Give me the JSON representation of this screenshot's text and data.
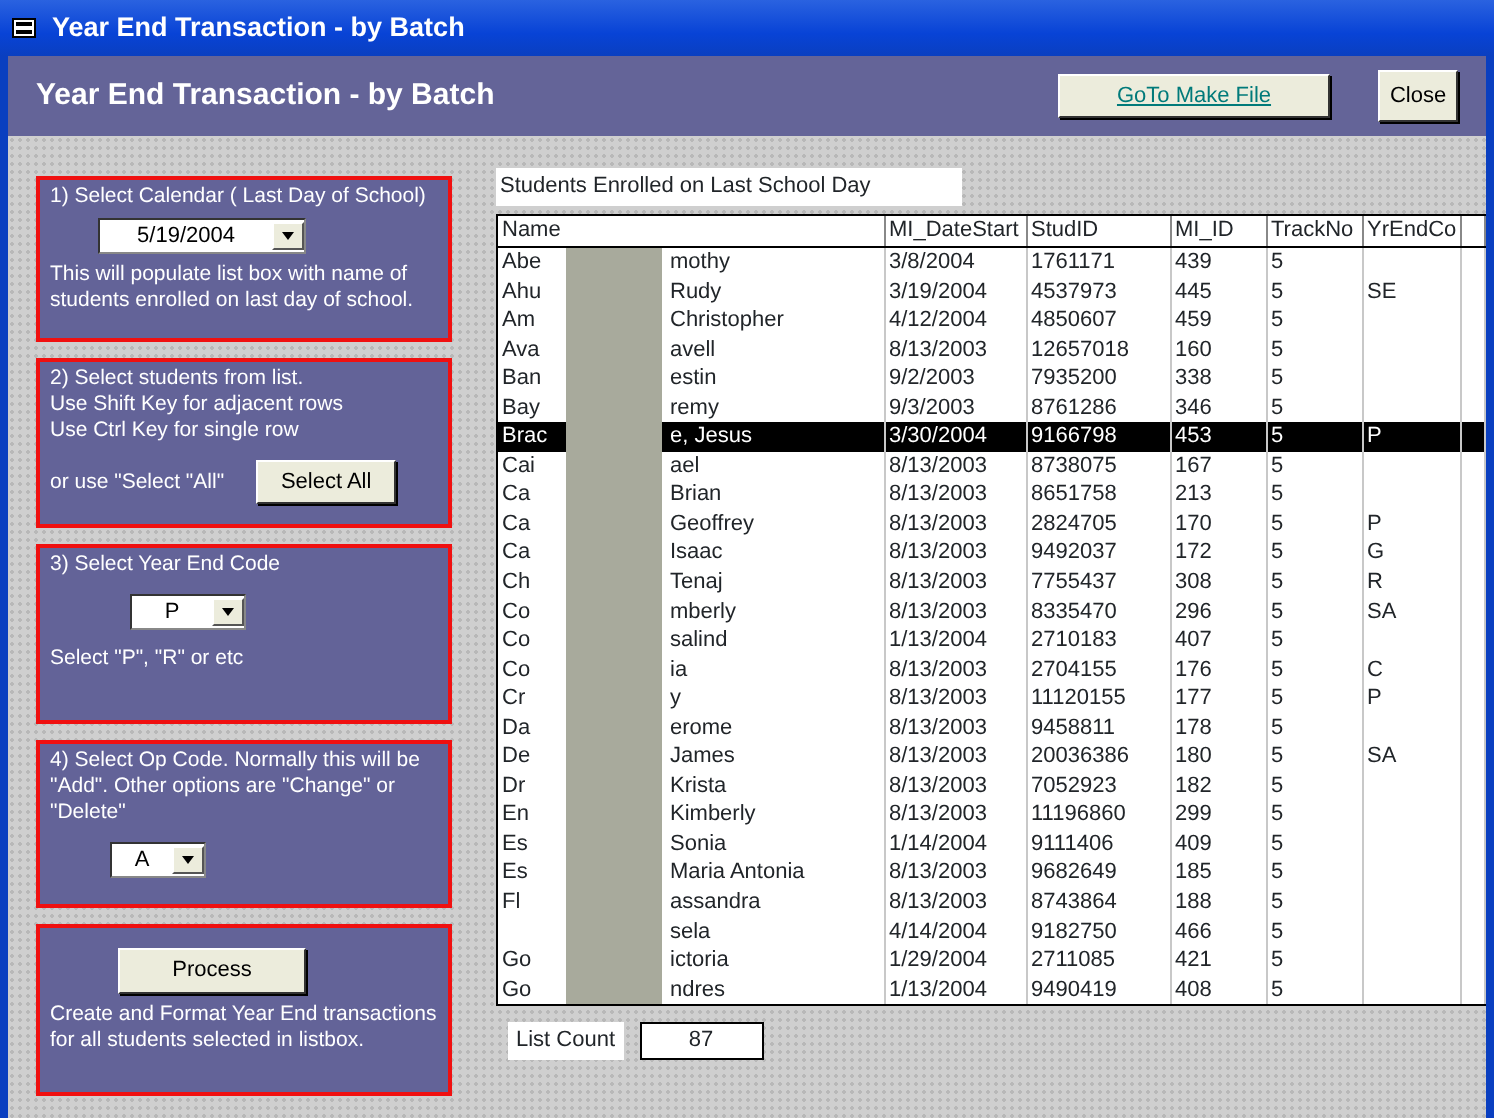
{
  "window": {
    "title": "Year End Transaction -  by Batch"
  },
  "header": {
    "title": "Year End Transaction -  by Batch",
    "buttons": [
      {
        "label": "GoTo Make File",
        "kind": "link"
      },
      {
        "label": "Close",
        "kind": "plain"
      }
    ]
  },
  "steps": [
    {
      "kind": "calendar",
      "label": "1)  Select Calendar ( Last Day of School)",
      "value": "5/19/2004",
      "note": "This will populate list box with name of students enrolled on last day of school."
    },
    {
      "kind": "select_all",
      "lines": [
        "2)  Select students from list.",
        "Use Shift Key for adjacent rows",
        "Use Ctrl Key for single row"
      ],
      "note": "or use \"Select \"All\"",
      "button": "Select All"
    },
    {
      "kind": "code",
      "label": "3) Select Year End Code",
      "value": "P",
      "note": "Select \"P\", \"R\" or etc"
    },
    {
      "kind": "opcode",
      "label": "4) Select Op Code.  Normally this will be \"Add\".  Other options are \"Change\" or \"Delete\"",
      "value": "A"
    },
    {
      "kind": "process",
      "button": "Process",
      "note": "Create and Format Year End transactions for all students selected in listbox."
    }
  ],
  "list": {
    "caption": "Students Enrolled on Last School Day",
    "columns": [
      "Name",
      "MI_DateStart",
      "StudID",
      "MI_ID",
      "TrackNo",
      "YrEndCo"
    ],
    "rows": [
      {
        "cells": [
          {
            "start": "Abe",
            "end": "mothy"
          },
          "3/8/2004",
          "1761171",
          "439",
          "5",
          ""
        ],
        "selected": false
      },
      {
        "cells": [
          {
            "start": "Ahu",
            "end": "Rudy"
          },
          "3/19/2004",
          "4537973",
          "445",
          "5",
          "SE"
        ],
        "selected": false
      },
      {
        "cells": [
          {
            "start": "Am",
            "end": "Christopher"
          },
          "4/12/2004",
          "4850607",
          "459",
          "5",
          ""
        ],
        "selected": false
      },
      {
        "cells": [
          {
            "start": "Ava",
            "end": "avell"
          },
          "8/13/2003",
          "12657018",
          "160",
          "5",
          ""
        ],
        "selected": false
      },
      {
        "cells": [
          {
            "start": "Ban",
            "end": "estin"
          },
          "9/2/2003",
          "7935200",
          "338",
          "5",
          ""
        ],
        "selected": false
      },
      {
        "cells": [
          {
            "start": "Bay",
            "end": "remy"
          },
          "9/3/2003",
          "8761286",
          "346",
          "5",
          ""
        ],
        "selected": false
      },
      {
        "cells": [
          {
            "start": "Brac",
            "end": "e,  Jesus"
          },
          "3/30/2004",
          "9166798",
          "453",
          "5",
          "P"
        ],
        "selected": true
      },
      {
        "cells": [
          {
            "start": "Cai",
            "end": "ael"
          },
          "8/13/2003",
          "8738075",
          "167",
          "5",
          ""
        ],
        "selected": false
      },
      {
        "cells": [
          {
            "start": "Ca",
            "end": "Brian"
          },
          "8/13/2003",
          "8651758",
          "213",
          "5",
          ""
        ],
        "selected": false
      },
      {
        "cells": [
          {
            "start": "Ca",
            "end": "Geoffrey"
          },
          "8/13/2003",
          "2824705",
          "170",
          "5",
          "P"
        ],
        "selected": false
      },
      {
        "cells": [
          {
            "start": "Ca",
            "end": "Isaac"
          },
          "8/13/2003",
          "9492037",
          "172",
          "5",
          "G"
        ],
        "selected": false
      },
      {
        "cells": [
          {
            "start": "Ch",
            "end": "Tenaj"
          },
          "8/13/2003",
          "7755437",
          "308",
          "5",
          "R"
        ],
        "selected": false
      },
      {
        "cells": [
          {
            "start": "Co",
            "end": "mberly"
          },
          "8/13/2003",
          "8335470",
          "296",
          "5",
          "SA"
        ],
        "selected": false
      },
      {
        "cells": [
          {
            "start": "Co",
            "end": "salind"
          },
          "1/13/2004",
          "2710183",
          "407",
          "5",
          ""
        ],
        "selected": false
      },
      {
        "cells": [
          {
            "start": "Co",
            "end": "ia"
          },
          "8/13/2003",
          "2704155",
          "176",
          "5",
          "C"
        ],
        "selected": false
      },
      {
        "cells": [
          {
            "start": "Cr",
            "end": "y"
          },
          "8/13/2003",
          "11120155",
          "177",
          "5",
          "P"
        ],
        "selected": false
      },
      {
        "cells": [
          {
            "start": "Da",
            "end": "erome"
          },
          "8/13/2003",
          "9458811",
          "178",
          "5",
          ""
        ],
        "selected": false
      },
      {
        "cells": [
          {
            "start": "De",
            "end": "James"
          },
          "8/13/2003",
          "20036386",
          "180",
          "5",
          "SA"
        ],
        "selected": false
      },
      {
        "cells": [
          {
            "start": "Dr",
            "end": "Krista"
          },
          "8/13/2003",
          "7052923",
          "182",
          "5",
          ""
        ],
        "selected": false
      },
      {
        "cells": [
          {
            "start": "En",
            "end": "Kimberly"
          },
          "8/13/2003",
          "11196860",
          "299",
          "5",
          ""
        ],
        "selected": false
      },
      {
        "cells": [
          {
            "start": "Es",
            "end": "Sonia"
          },
          "1/14/2004",
          "9111406",
          "409",
          "5",
          ""
        ],
        "selected": false
      },
      {
        "cells": [
          {
            "start": "Es",
            "end": "Maria Antonia"
          },
          "8/13/2003",
          "9682649",
          "185",
          "5",
          ""
        ],
        "selected": false
      },
      {
        "cells": [
          {
            "start": "Fl",
            "end": "assandra"
          },
          "8/13/2003",
          "8743864",
          "188",
          "5",
          ""
        ],
        "selected": false
      },
      {
        "cells": [
          {
            "end": "sela"
          },
          "4/14/2004",
          "9182750",
          "466",
          "5",
          ""
        ],
        "selected": false
      },
      {
        "cells": [
          {
            "start": "Go",
            "end": "ictoria"
          },
          "1/29/2004",
          "2711085",
          "421",
          "5",
          ""
        ],
        "selected": false
      },
      {
        "cells": [
          {
            "start": "Go",
            "end": "ndres"
          },
          "1/13/2004",
          "9490419",
          "408",
          "5",
          ""
        ],
        "selected": false
      }
    ]
  },
  "list_count": {
    "label": "List Count",
    "value": "87"
  }
}
